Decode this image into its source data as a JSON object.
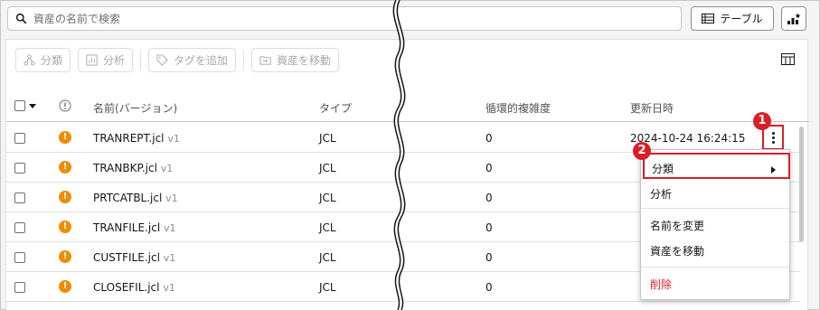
{
  "search": {
    "placeholder": "資産の名前で検索"
  },
  "view_button": {
    "label": "テーブル"
  },
  "toolbar": {
    "classify": "分類",
    "analyze": "分析",
    "add_tag": "タグを追加",
    "move_asset": "資産を移動"
  },
  "columns": {
    "name": "名前(バージョン)",
    "type": "タイプ",
    "complexity": "循環的複雑度",
    "updated": "更新日時"
  },
  "rows": [
    {
      "name": "TRANREPT.jcl",
      "version": "v1",
      "type": "JCL",
      "complexity": "0",
      "updated": "2024-10-24 16:24:15"
    },
    {
      "name": "TRANBKP.jcl",
      "version": "v1",
      "type": "JCL",
      "complexity": "0"
    },
    {
      "name": "PRTCATBL.jcl",
      "version": "v1",
      "type": "JCL",
      "complexity": "0"
    },
    {
      "name": "TRANFILE.jcl",
      "version": "v1",
      "type": "JCL",
      "complexity": "0"
    },
    {
      "name": "CUSTFILE.jcl",
      "version": "v1",
      "type": "JCL",
      "complexity": "0"
    },
    {
      "name": "CLOSEFIL.jcl",
      "version": "v1",
      "type": "JCL",
      "complexity": "0"
    }
  ],
  "context_menu": {
    "classify": "分類",
    "analyze": "分析",
    "rename": "名前を変更",
    "move_asset": "資産を移動",
    "delete": "削除"
  },
  "callouts": {
    "one": "1",
    "two": "2"
  },
  "colors": {
    "accent_red": "#da1e28",
    "warning_orange": "#f08c00"
  }
}
